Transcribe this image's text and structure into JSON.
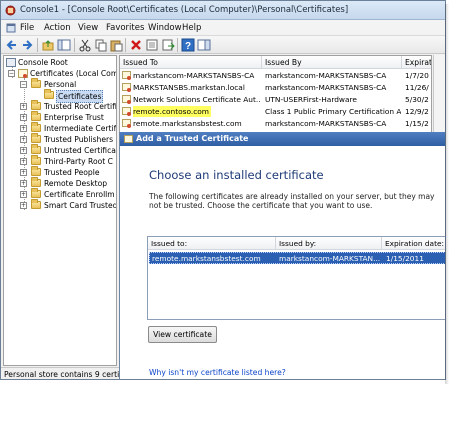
{
  "window": {
    "title": "Console1 - [Console Root\\Certificates (Local Computer)\\Personal\\Certificates]"
  },
  "menu": [
    "File",
    "Action",
    "View",
    "Favorites",
    "Window",
    "Help"
  ],
  "tree": {
    "items": [
      {
        "label": "Console Root"
      },
      {
        "label": "Certificates (Local Com"
      },
      {
        "label": "Personal"
      },
      {
        "label": "Certificates"
      },
      {
        "label": "Trusted Root Certifi"
      },
      {
        "label": "Enterprise Trust"
      },
      {
        "label": "Intermediate Certif"
      },
      {
        "label": "Trusted Publishers"
      },
      {
        "label": "Untrusted Certifica"
      },
      {
        "label": "Third-Party Root C"
      },
      {
        "label": "Trusted People"
      },
      {
        "label": "Remote Desktop"
      },
      {
        "label": "Certificate Enrollm"
      },
      {
        "label": "Smart Card Trusted"
      }
    ]
  },
  "status_text": "Personal store contains 9 certificat",
  "list": {
    "columns": [
      "Issued To",
      "Issued By",
      "Expirat"
    ],
    "rows": [
      {
        "issued_to": "markstancom-MARKSTANSBS-CA",
        "issued_by": "markstancom-MARKSTANSBS-CA",
        "exp": "1/7/20"
      },
      {
        "issued_to": "MARKSTANSBS.markstan.local",
        "issued_by": "markstancom-MARKSTANSBS-CA",
        "exp": "11/26/"
      },
      {
        "issued_to": "Network Solutions Certificate Aut...",
        "issued_by": "UTN-USERFirst-Hardware",
        "exp": "5/30/2"
      },
      {
        "issued_to": "remote.contoso.com",
        "issued_by": "Class 1 Public Primary Certification A...",
        "exp": "12/9/2"
      },
      {
        "issued_to": "remote.markstansbstest.com",
        "issued_by": "markstancom-MARKSTANSBS-CA",
        "exp": "1/15/2"
      }
    ]
  },
  "dialog": {
    "title": "Add a Trusted Certificate",
    "heading": "Choose an installed certificate",
    "description": "The following certificates are already installed on your server, but they may not be trusted. Choose the certificate that you want to use.",
    "columns": [
      "Issued to:",
      "Issued by:",
      "Expiration date:"
    ],
    "rows": [
      {
        "issued_to": "remote.markstansbstest.com",
        "issued_by": "markstancom-MARKSTAN...",
        "exp": "1/15/2011"
      }
    ],
    "view_button": "View certificate",
    "help_link": "Why isn't my certificate listed here?"
  },
  "colors": {
    "highlight": "#ffff60",
    "selection": "#2a5fb2",
    "dialog_title": "#2f5ea3",
    "heading": "#1f3b78",
    "link": "#0b44c8"
  }
}
